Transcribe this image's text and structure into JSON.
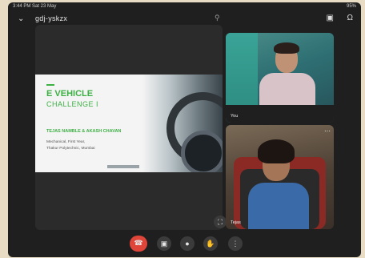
{
  "status_bar": {
    "time_date": "3:44 PM Sat 23 May",
    "battery": "95%"
  },
  "header": {
    "meeting_name": "gdj-yskzx",
    "meeting_sub": "",
    "back_icon": "chevron-down-icon",
    "switch_camera_icon": "camera-switch-icon",
    "audio_icon": "headphones-icon",
    "search_icon": "search-icon"
  },
  "presentation": {
    "heading_line1": "E VEHICLE",
    "heading_line2": "CHALLENGE I",
    "names": "TEJAS NAMBLE & AKASH CHAVAN",
    "line1": "Mechanical, First Year,",
    "line2": "Thakur Polytechnic, Mumbai"
  },
  "participants": [
    {
      "label": "You"
    },
    {
      "label": "Tejas",
      "menu_icon": "more-icon"
    }
  ],
  "controls": {
    "end_icon": "end-call-icon",
    "camera_icon": "camera-icon",
    "mic_icon": "mic-icon",
    "hand_icon": "raise-hand-icon",
    "more_icon": "more-vertical-icon"
  },
  "colors": {
    "accent_green": "#3cb043",
    "end_call_red": "#e0453a",
    "background": "#1f1f1f"
  }
}
